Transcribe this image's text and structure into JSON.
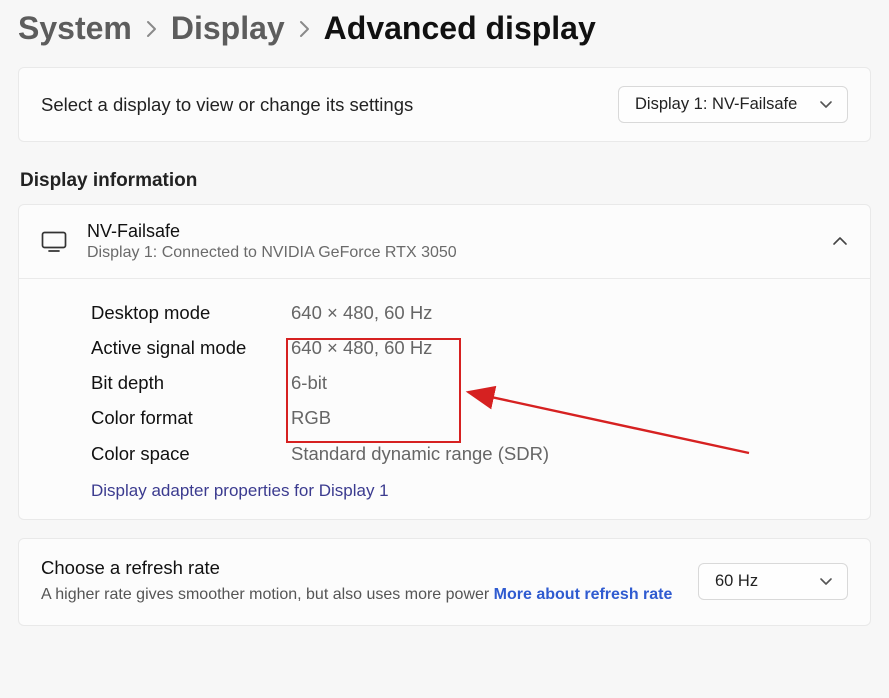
{
  "breadcrumb": {
    "system": "System",
    "display": "Display",
    "current": "Advanced display"
  },
  "selector": {
    "label": "Select a display to view or change its settings",
    "dropdown_value": "Display 1: NV-Failsafe"
  },
  "section_title": "Display information",
  "display": {
    "name": "NV-Failsafe",
    "subtitle": "Display 1: Connected to NVIDIA GeForce RTX 3050",
    "rows": {
      "desktop_mode": {
        "k": "Desktop mode",
        "v": "640 × 480, 60 Hz"
      },
      "active_signal": {
        "k": "Active signal mode",
        "v": "640 × 480, 60 Hz"
      },
      "bit_depth": {
        "k": "Bit depth",
        "v": "6-bit"
      },
      "color_format": {
        "k": "Color format",
        "v": "RGB"
      },
      "color_space": {
        "k": "Color space",
        "v": "Standard dynamic range (SDR)"
      }
    },
    "adapter_link": "Display adapter properties for Display 1"
  },
  "refresh": {
    "title": "Choose a refresh rate",
    "subtitle_lead": "A higher rate gives smoother motion, but also uses more power  ",
    "learn_more": "More about refresh rate",
    "dropdown_value": "60 Hz"
  }
}
